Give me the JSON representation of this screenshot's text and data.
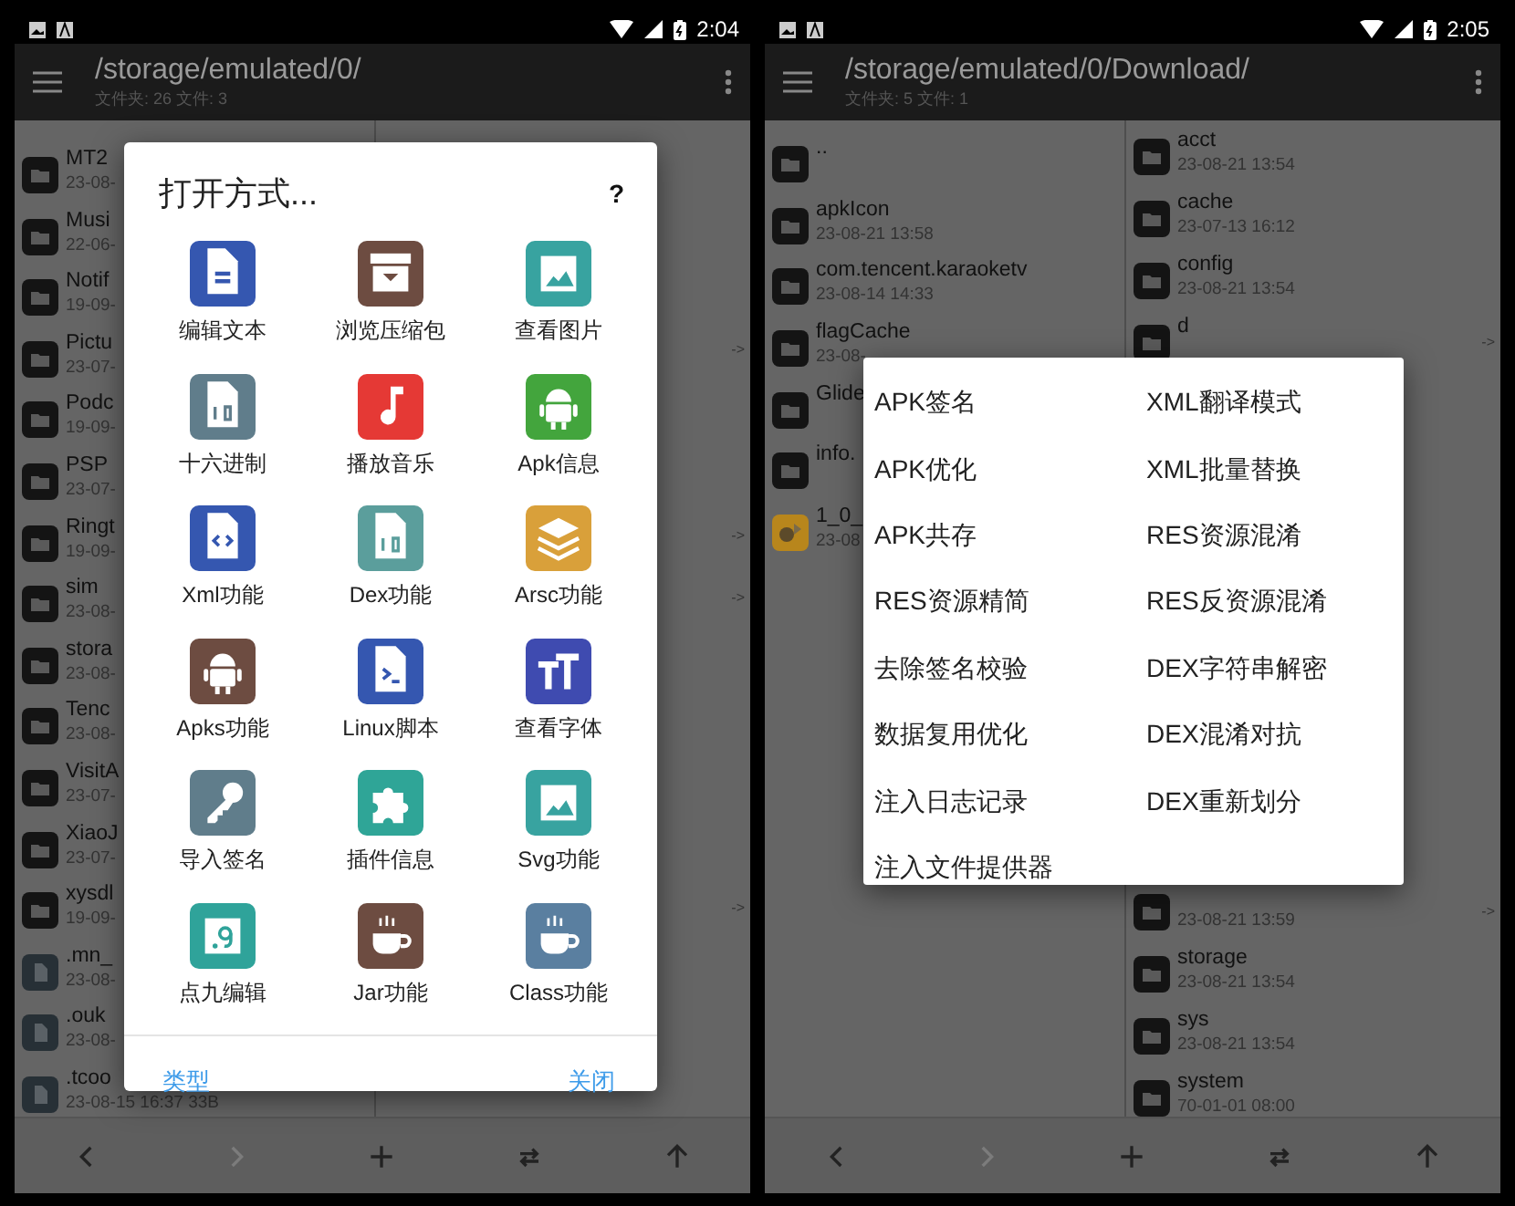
{
  "phones": [
    {
      "status_bar": {
        "time": "2:04"
      },
      "app_bar": {
        "path": "/storage/emulated/0/",
        "summary": "文件夹: 26  文件: 3"
      },
      "left_pane": {
        "rows": [
          {
            "kind": "folder",
            "name": "MT2",
            "date": "23-08-"
          },
          {
            "kind": "folder",
            "name": "Musi",
            "date": "22-06-"
          },
          {
            "kind": "folder",
            "name": "Notif",
            "date": "19-09-"
          },
          {
            "kind": "folder",
            "name": "Pictu",
            "date": "23-07-"
          },
          {
            "kind": "folder",
            "name": "Podc",
            "date": "19-09-"
          },
          {
            "kind": "folder",
            "name": "PSP",
            "date": "23-07-"
          },
          {
            "kind": "folder",
            "name": "Ringt",
            "date": "19-09-"
          },
          {
            "kind": "folder",
            "name": "sim",
            "date": "23-08-"
          },
          {
            "kind": "folder",
            "name": "stora",
            "date": "23-08-"
          },
          {
            "kind": "folder",
            "name": "Tenc",
            "date": "23-08-"
          },
          {
            "kind": "folder",
            "name": "VisitA",
            "date": "23-07-"
          },
          {
            "kind": "folder",
            "name": "XiaoJ",
            "date": "23-07-"
          },
          {
            "kind": "folder",
            "name": "xysdl",
            "date": "19-09-"
          },
          {
            "kind": "file",
            "name": ".mn_",
            "date": "23-08-"
          },
          {
            "kind": "file",
            "name": ".ouk",
            "date": "23-08-"
          },
          {
            "kind": "file",
            "name": ".tcoo",
            "date": "23-08-15 16:37  33B"
          }
        ]
      },
      "right_pane": {
        "top_rows": [
          {
            "symlink": false
          },
          {
            "symlink": false
          },
          {
            "symlink": false
          },
          {
            "symlink": true,
            "mark": "->"
          },
          {
            "symlink": false
          },
          {
            "symlink": false
          },
          {
            "symlink": true,
            "mark": "->"
          },
          {
            "symlink": true,
            "mark": "->"
          },
          {
            "symlink": false
          },
          {
            "symlink": false
          },
          {
            "symlink": false
          },
          {
            "symlink": false
          },
          {
            "symlink": true,
            "mark": "->"
          }
        ]
      },
      "dialog": {
        "title": "打开方式...",
        "help": "?",
        "items": [
          {
            "label": "编辑文本",
            "kind": "document",
            "color": "#3557b0"
          },
          {
            "label": "浏览压缩包",
            "kind": "archive",
            "color": "#6d4c41"
          },
          {
            "label": "查看图片",
            "kind": "image",
            "color": "#38a3a0"
          },
          {
            "label": "十六进制",
            "kind": "binary",
            "color": "#607d8b"
          },
          {
            "label": "播放音乐",
            "kind": "music",
            "color": "#e53935"
          },
          {
            "label": "Apk信息",
            "kind": "android",
            "color": "#43a53d"
          },
          {
            "label": "Xml功能",
            "kind": "code",
            "color": "#3557b0"
          },
          {
            "label": "Dex功能",
            "kind": "binary",
            "color": "#5b9e9c"
          },
          {
            "label": "Arsc功能",
            "kind": "layers",
            "color": "#d9a03a"
          },
          {
            "label": "Apks功能",
            "kind": "android",
            "color": "#6d4c41"
          },
          {
            "label": "Linux脚本",
            "kind": "script",
            "color": "#3557b0"
          },
          {
            "label": "查看字体",
            "kind": "font",
            "color": "#3f4bb0"
          },
          {
            "label": "导入签名",
            "kind": "key",
            "color": "#607d8b"
          },
          {
            "label": "插件信息",
            "kind": "puzzle",
            "color": "#2fa597"
          },
          {
            "label": "Svg功能",
            "kind": "image",
            "color": "#38a3a0"
          },
          {
            "label": "点九编辑",
            "kind": "ninepatch",
            "color": "#2fa39a"
          },
          {
            "label": "Jar功能",
            "kind": "cup",
            "color": "#6d4c41"
          },
          {
            "label": "Class功能",
            "kind": "cup",
            "color": "#5a7fa0"
          }
        ],
        "buttons": [
          {
            "label": "类型"
          },
          {
            "label": "关闭"
          }
        ]
      },
      "nav": [
        {
          "kind": "back",
          "disabled": false
        },
        {
          "kind": "forward",
          "disabled": true
        },
        {
          "kind": "add",
          "disabled": false
        },
        {
          "kind": "swap",
          "disabled": false
        },
        {
          "kind": "up",
          "disabled": false
        }
      ]
    },
    {
      "status_bar": {
        "time": "2:05"
      },
      "app_bar": {
        "path": "/storage/emulated/0/Download/",
        "summary": "文件夹: 5  文件: 1"
      },
      "left_pane": {
        "rows": [
          {
            "kind": "folder",
            "name": ".."
          },
          {
            "kind": "folder",
            "name": "apkIcon",
            "date": "23-08-21 13:58"
          },
          {
            "kind": "folder",
            "name": "com.tencent.karaoketv",
            "date": "23-08-14 14:33"
          },
          {
            "kind": "folder",
            "name": "flagCache",
            "date": "23-08-"
          },
          {
            "kind": "folder",
            "name": "Glide"
          },
          {
            "kind": "folder",
            "name": "info."
          },
          {
            "kind": "apk",
            "name": "1_0_",
            "date": "23-08"
          }
        ]
      },
      "right_pane": {
        "top_rows": [
          {
            "symlink": false,
            "name": "acct",
            "date": "23-08-21 13:54"
          },
          {
            "symlink": false,
            "name": "cache",
            "date": "23-07-13 16:12"
          },
          {
            "symlink": false,
            "name": "config",
            "date": "23-08-21 13:54"
          },
          {
            "symlink": true,
            "mark": "->",
            "name": "d"
          }
        ],
        "bottom_rows": [
          {
            "symlink": true,
            "mark": "->",
            "date": "23-08-21 13:59"
          },
          {
            "symlink": false,
            "name": "storage",
            "date": "23-08-21 13:54"
          },
          {
            "symlink": false,
            "name": "sys",
            "date": "23-08-21 13:54"
          },
          {
            "symlink": false,
            "name": "system",
            "date": "70-01-01 08:00"
          }
        ]
      },
      "menu": {
        "items": [
          {
            "label": "APK签名"
          },
          {
            "label": "XML翻译模式"
          },
          {
            "label": "APK优化"
          },
          {
            "label": "XML批量替换"
          },
          {
            "label": "APK共存"
          },
          {
            "label": "RES资源混淆"
          },
          {
            "label": "RES资源精简"
          },
          {
            "label": "RES反资源混淆"
          },
          {
            "label": "去除签名校验"
          },
          {
            "label": "DEX字符串解密"
          },
          {
            "label": "数据复用优化"
          },
          {
            "label": "DEX混淆对抗"
          },
          {
            "label": "注入日志记录"
          },
          {
            "label": "DEX重新划分"
          },
          {
            "label": "注入文件提供器"
          }
        ]
      },
      "nav": [
        {
          "kind": "back",
          "disabled": false
        },
        {
          "kind": "forward",
          "disabled": true
        },
        {
          "kind": "add",
          "disabled": false
        },
        {
          "kind": "swap",
          "disabled": false
        },
        {
          "kind": "up",
          "disabled": false
        }
      ]
    }
  ]
}
